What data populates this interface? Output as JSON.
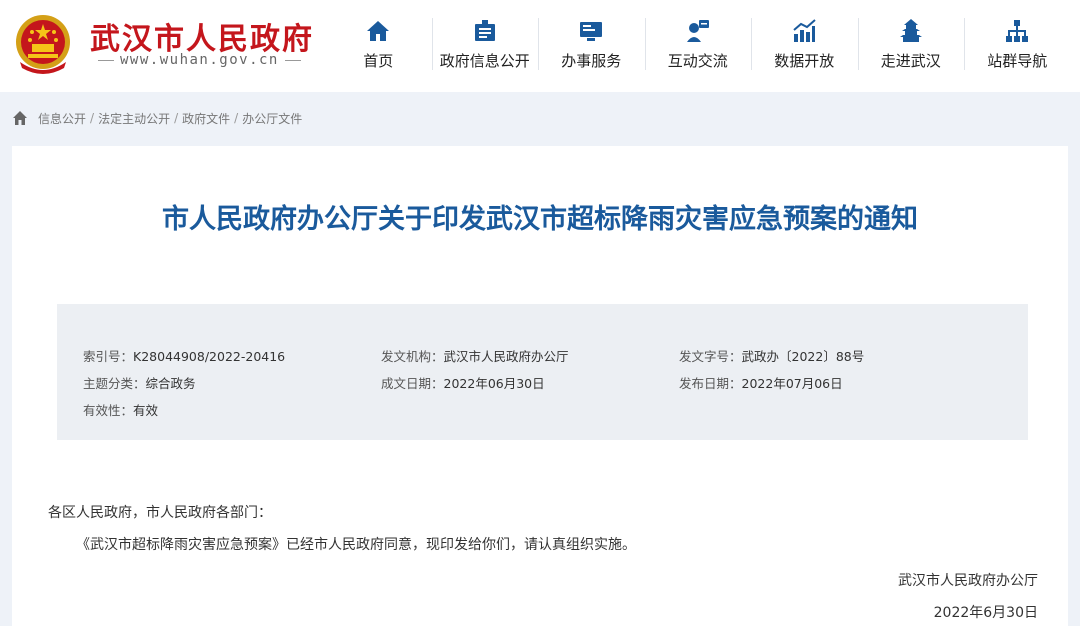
{
  "site": {
    "title": "武汉市人民政府",
    "url": "www.wuhan.gov.cn"
  },
  "nav": [
    {
      "label": "首页",
      "icon": "home-icon"
    },
    {
      "label": "政府信息公开",
      "icon": "info-disclosure-icon"
    },
    {
      "label": "办事服务",
      "icon": "service-icon"
    },
    {
      "label": "互动交流",
      "icon": "interaction-icon"
    },
    {
      "label": "数据开放",
      "icon": "data-chart-icon"
    },
    {
      "label": "走进武汉",
      "icon": "tower-icon"
    },
    {
      "label": "站群导航",
      "icon": "sitemap-icon"
    }
  ],
  "breadcrumb": [
    "信息公开",
    "法定主动公开",
    "政府文件",
    "办公厅文件"
  ],
  "doc": {
    "title": "市人民政府办公厅关于印发武汉市超标降雨灾害应急预案的通知"
  },
  "meta": {
    "index_label": "索引号：",
    "index_value": "K28044908/2022-20416",
    "issuer_label": "发文机构：",
    "issuer_value": "武汉市人民政府办公厅",
    "docno_label": "发文字号：",
    "docno_value": "武政办〔2022〕88号",
    "topic_label": "主题分类：",
    "topic_value": "综合政务",
    "created_label": "成文日期：",
    "created_value": "2022年06月30日",
    "published_label": "发布日期：",
    "published_value": "2022年07月06日",
    "validity_label": "有效性：",
    "validity_value": "有效"
  },
  "body": {
    "salutation": "各区人民政府，市人民政府各部门：",
    "paragraph": "《武汉市超标降雨灾害应急预案》已经市人民政府同意，现印发给你们，请认真组织实施。",
    "signatory": "武汉市人民政府办公厅",
    "date": "2022年6月30日"
  },
  "colors": {
    "brand_red": "#c4161c",
    "title_blue": "#1a5a9c",
    "nav_icon_blue": "#1a5a9c"
  }
}
